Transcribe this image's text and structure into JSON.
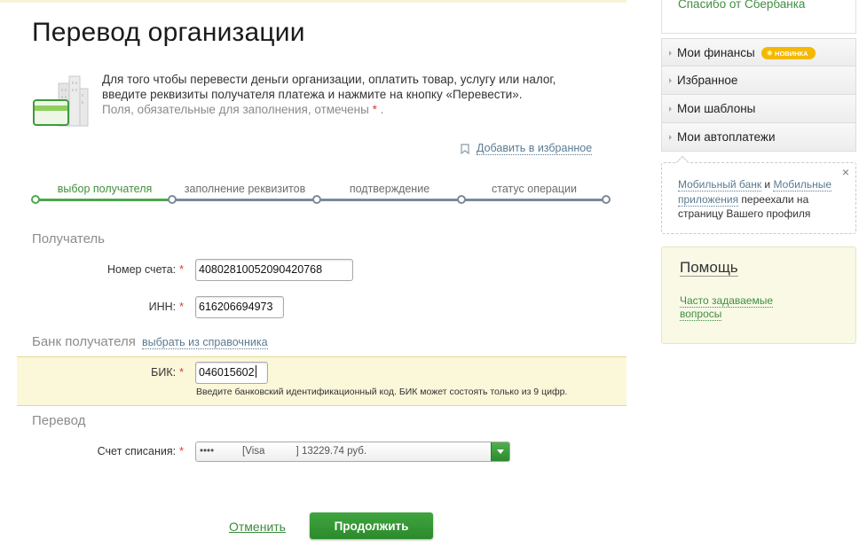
{
  "page": {
    "title": "Перевод организации",
    "intro_line1": "Для того чтобы перевести деньги организации, оплатить товар, услугу или налог,",
    "intro_line2": "введите реквизиты получателя платежа и нажмите на кнопку «Перевести».",
    "required_note": "Поля, обязательные для заполнения, отмечены",
    "required_mark": "*",
    "note_end": ".",
    "add_favorite": "Добавить в избранное"
  },
  "steps": [
    {
      "label": "выбор получателя",
      "active": true
    },
    {
      "label": "заполнение реквизитов",
      "active": false
    },
    {
      "label": "подтверждение",
      "active": false
    },
    {
      "label": "статус операции",
      "active": false
    }
  ],
  "recipient": {
    "heading": "Получатель",
    "account_label": "Номер счета:",
    "account_value": "40802810052090420768",
    "inn_label": "ИНН:",
    "inn_value": "616206694973"
  },
  "bank": {
    "heading": "Банк получателя",
    "choose_link": "выбрать из справочника",
    "bik_label": "БИК:",
    "bik_value": "046015602",
    "bik_hint": "Введите банковский идентификационный код. БИК может состоять только из 9 цифр."
  },
  "transfer": {
    "heading": "Перевод",
    "source_label": "Счет списания:",
    "source_value": "••••          [Visa           ] 13229.74 руб."
  },
  "actions": {
    "cancel": "Отменить",
    "continue": "Продолжить"
  },
  "sidebar": {
    "top_link": "Спасибо от Сбербанка",
    "menu": [
      {
        "label": "Мои финансы",
        "badge": "НОВИНКА"
      },
      {
        "label": "Избранное"
      },
      {
        "label": "Мои шаблоны"
      },
      {
        "label": "Мои автоплатежи"
      }
    ],
    "notice": {
      "link1": "Мобильный банк",
      "and": " и ",
      "link2": "Мобильные приложения",
      "rest": " переехали на страницу Вашего профиля",
      "close": "×"
    },
    "help": {
      "title": "Помощь",
      "faq": "Часто задаваемые вопросы"
    }
  },
  "colors": {
    "brand_green": "#3e8f3e",
    "highlight_yellow": "#fbf7d9",
    "required_red": "#e03a2e",
    "link_blue": "#5a7b92"
  }
}
